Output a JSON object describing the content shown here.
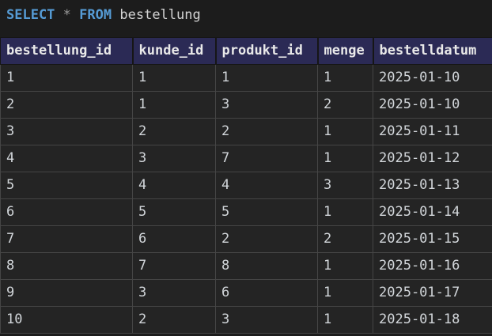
{
  "query": {
    "keyword_select": "SELECT",
    "operator": "*",
    "keyword_from": "FROM",
    "identifier": "bestellung"
  },
  "result_table": {
    "columns": [
      "bestellung_id",
      "kunde_id",
      "produkt_id",
      "menge",
      "bestelldatum"
    ],
    "rows": [
      [
        "1",
        "1",
        "1",
        "1",
        "2025-01-10"
      ],
      [
        "2",
        "1",
        "3",
        "2",
        "2025-01-10"
      ],
      [
        "3",
        "2",
        "2",
        "1",
        "2025-01-11"
      ],
      [
        "4",
        "3",
        "7",
        "1",
        "2025-01-12"
      ],
      [
        "5",
        "4",
        "4",
        "3",
        "2025-01-13"
      ],
      [
        "6",
        "5",
        "5",
        "1",
        "2025-01-14"
      ],
      [
        "7",
        "6",
        "2",
        "2",
        "2025-01-15"
      ],
      [
        "8",
        "7",
        "8",
        "1",
        "2025-01-16"
      ],
      [
        "9",
        "3",
        "6",
        "1",
        "2025-01-17"
      ],
      [
        "10",
        "2",
        "3",
        "1",
        "2025-01-18"
      ]
    ]
  },
  "colors": {
    "background": "#1c1c1c",
    "header_bg": "#2b2a55",
    "cell_bg": "#242424",
    "cell_border": "#454545",
    "keyword_blue": "#569cd6",
    "operator_gray": "#9a9a9a",
    "text": "#d2d6da"
  }
}
